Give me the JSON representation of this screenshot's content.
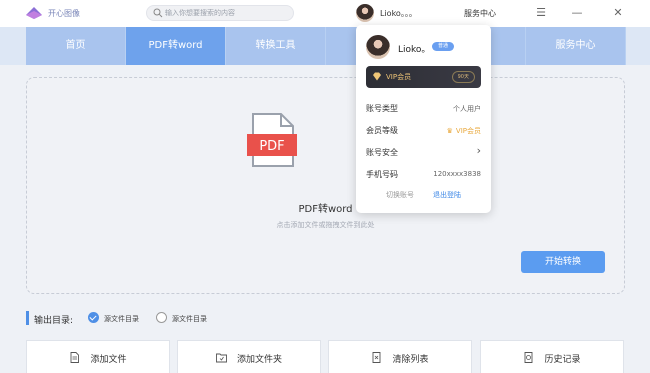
{
  "titlebar": {
    "logo_text": "开心图像",
    "search_placeholder": "输入你想要搜索的内容",
    "user_name": "Lioko。。。",
    "service_label": "服务中心",
    "menu_glyph": "☰",
    "min_glyph": "—",
    "close_glyph": "✕"
  },
  "nav": {
    "items": [
      {
        "label": "首页"
      },
      {
        "label": "PDF转word"
      },
      {
        "label": "转换工具"
      },
      {
        "label": ""
      },
      {
        "label": ""
      },
      {
        "label": "服务中心"
      }
    ]
  },
  "main": {
    "pdf_icon_text": "PDF",
    "drop_title": "PDF转word",
    "drop_hint": "点击添加文件或拖拽文件到此处",
    "start_button": "开始转换"
  },
  "output": {
    "label": "输出目录:",
    "options": [
      {
        "label": "源文件目录",
        "checked": true
      },
      {
        "label": "源文件目录",
        "checked": false
      }
    ]
  },
  "bottom_buttons": [
    {
      "label": "添加文件",
      "icon": "file-icon"
    },
    {
      "label": "添加文件夹",
      "icon": "folder-icon"
    },
    {
      "label": "清除列表",
      "icon": "clear-list-icon"
    },
    {
      "label": "历史记录",
      "icon": "history-icon"
    }
  ],
  "popup": {
    "user_name": "Lioko。",
    "badge": "普通",
    "vip_card": {
      "name": "VIP会员",
      "days": "90天"
    },
    "rows": [
      {
        "label": "账号类型",
        "value": "个人用户"
      },
      {
        "label": "会员等级",
        "value": "VIP会员"
      },
      {
        "label": "账号安全",
        "value": "›"
      },
      {
        "label": "手机号码",
        "value": "120xxxx3838"
      }
    ],
    "switch_account": "切换账号",
    "logout": "退出登陆"
  },
  "colors": {
    "nav_active": "#6ea2ec",
    "nav_item": "#a9c4ee",
    "accent": "#5b9cf0",
    "pdf_red": "#e9514b",
    "vip_gold": "#f0c677"
  }
}
